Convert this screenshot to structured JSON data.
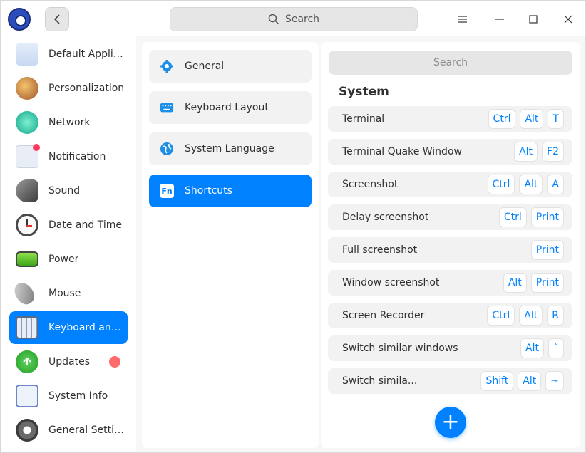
{
  "titlebar": {
    "search_placeholder": "Search",
    "back_icon": "chevron-left-icon",
    "menu_icon": "menu-icon",
    "minimize_icon": "minimize-icon",
    "maximize_icon": "maximize-icon",
    "close_icon": "close-icon"
  },
  "sidebar": {
    "items": [
      {
        "label": "Default Applic...",
        "icon": "default-apps-icon"
      },
      {
        "label": "Personalization",
        "icon": "palette-icon"
      },
      {
        "label": "Network",
        "icon": "network-icon"
      },
      {
        "label": "Notification",
        "icon": "notification-icon"
      },
      {
        "label": "Sound",
        "icon": "speaker-icon"
      },
      {
        "label": "Date and Time",
        "icon": "clock-icon"
      },
      {
        "label": "Power",
        "icon": "battery-icon"
      },
      {
        "label": "Mouse",
        "icon": "mouse-icon"
      },
      {
        "label": "Keyboard and ...",
        "icon": "keyboard-icon",
        "active": true
      },
      {
        "label": "Updates",
        "icon": "update-arrow-icon"
      },
      {
        "label": "System Info",
        "icon": "system-info-icon"
      },
      {
        "label": "General Settin...",
        "icon": "gear-icon"
      }
    ]
  },
  "middle": {
    "items": [
      {
        "label": "General",
        "icon": "gear-icon"
      },
      {
        "label": "Keyboard Layout",
        "icon": "keyboard-icon"
      },
      {
        "label": "System Language",
        "icon": "globe-icon"
      },
      {
        "label": "Shortcuts",
        "icon": "fn-key-icon",
        "active": true
      }
    ],
    "fn_glyph": "Fn"
  },
  "right": {
    "search_placeholder": "Search",
    "section_title": "System",
    "shortcuts": [
      {
        "label": "Terminal",
        "keys": [
          "Ctrl",
          "Alt",
          "T"
        ]
      },
      {
        "label": "Terminal Quake Window",
        "keys": [
          "Alt",
          "F2"
        ]
      },
      {
        "label": "Screenshot",
        "keys": [
          "Ctrl",
          "Alt",
          "A"
        ]
      },
      {
        "label": "Delay screenshot",
        "keys": [
          "Ctrl",
          "Print"
        ]
      },
      {
        "label": "Full screenshot",
        "keys": [
          "Print"
        ]
      },
      {
        "label": "Window screenshot",
        "keys": [
          "Alt",
          "Print"
        ]
      },
      {
        "label": "Screen Recorder",
        "keys": [
          "Ctrl",
          "Alt",
          "R"
        ]
      },
      {
        "label": "Switch similar windows",
        "keys": [
          "Alt",
          "`"
        ]
      },
      {
        "label": "Switch simila...",
        "keys": [
          "Shift",
          "Alt",
          "~"
        ]
      }
    ],
    "add_glyph": "+"
  },
  "colors": {
    "accent": "#0081ff",
    "badge": "#ff6b6b"
  }
}
